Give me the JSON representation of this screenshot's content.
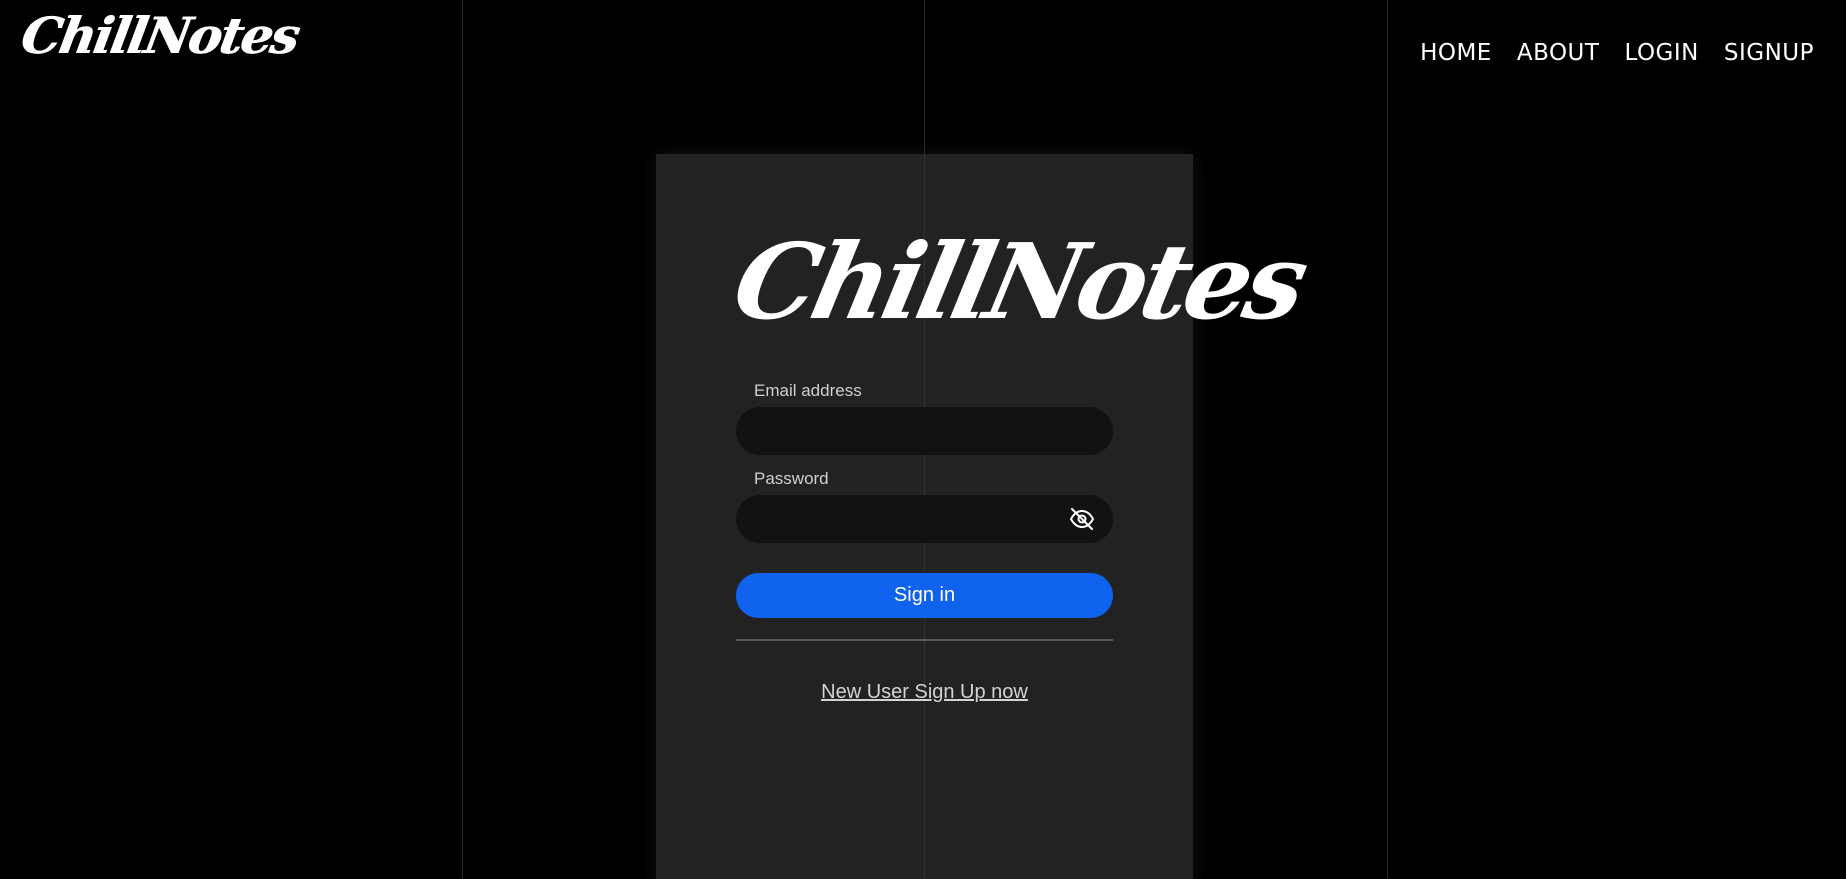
{
  "brand": {
    "name": "ChillNotes"
  },
  "nav": {
    "items": [
      {
        "label": "HOME"
      },
      {
        "label": "ABOUT"
      },
      {
        "label": "LOGIN"
      },
      {
        "label": "SIGNUP"
      }
    ]
  },
  "login": {
    "logo": "ChillNotes",
    "email": {
      "label": "Email address",
      "value": ""
    },
    "password": {
      "label": "Password",
      "value": "",
      "toggle_icon": "eye-off-icon"
    },
    "submit_label": "Sign in",
    "signup_link": "New User Sign Up now"
  },
  "colors": {
    "background": "#000000",
    "card": "#222222",
    "input": "#121212",
    "accent": "#1063ee"
  }
}
